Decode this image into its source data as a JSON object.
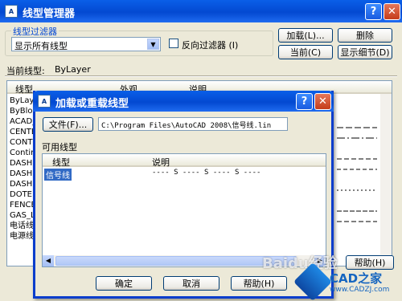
{
  "main": {
    "title": "线型管理器",
    "help_btn": "?",
    "close_btn": "✕",
    "filter_group": "线型过滤器",
    "filter_value": "显示所有线型",
    "invert_label": "反向过滤器 (I)",
    "buttons": {
      "load": "加载(L)...",
      "delete": "删除",
      "current": "当前(C)",
      "details": "显示细节(D)"
    },
    "current_label": "当前线型:",
    "current_value": "ByLayer",
    "columns": [
      "线型",
      "外观",
      "说明"
    ],
    "rows": [
      "ByLayer",
      "ByBlock",
      "ACAD_I",
      "CENTER",
      "CONTIN",
      "Contin",
      "DASH",
      "DASHED",
      "DASHED",
      "DOTE",
      "FENCEL",
      "GAS_LI",
      "电话线",
      "电源线"
    ],
    "help_button_partial": "帮助(H)"
  },
  "dialog": {
    "title": "加载或重载线型",
    "help_btn": "?",
    "close_btn": "✕",
    "file_button": "文件(F)...",
    "file_path": "C:\\Program Files\\AutoCAD 2008\\信号线.lin",
    "available_label": "可用线型",
    "columns": [
      "线型",
      "说明"
    ],
    "rows": [
      {
        "name": "信号线",
        "desc": "---- S ---- S ---- S ----"
      }
    ],
    "ok": "确定",
    "cancel": "取消",
    "help": "帮助(H)"
  },
  "watermark": {
    "baidu": "Baidu经验",
    "site": "www.CADZJ.com",
    "brand": "CAD之家"
  }
}
